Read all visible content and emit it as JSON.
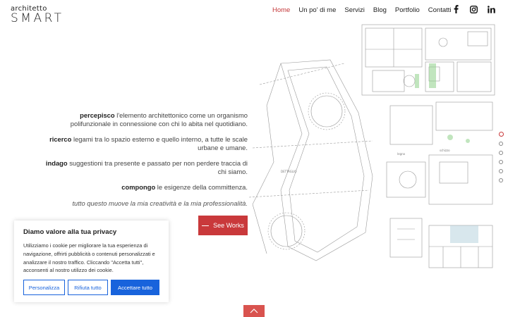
{
  "header": {
    "logo_top": "architetto",
    "logo_bottom": "SMART",
    "nav": [
      {
        "label": "Home",
        "active": true
      },
      {
        "label": "Un po' di me",
        "active": false
      },
      {
        "label": "Servizi",
        "active": false
      },
      {
        "label": "Blog",
        "active": false
      },
      {
        "label": "Portfolio",
        "active": false
      },
      {
        "label": "Contatti",
        "active": false
      }
    ],
    "social": [
      "facebook-icon",
      "instagram-icon",
      "linkedin-icon"
    ]
  },
  "manifesto": {
    "p1_bold": "percepisco",
    "p1_text": " l'elemento architettonico come un organismo polifunzionale in connessione con chi lo abita nel quotidiano.",
    "p2_bold": "ricerco",
    "p2_text": " legami tra lo spazio esterno e quello interno, a tutte le scale urbane e umane.",
    "p3_bold": "indago",
    "p3_text": " suggestioni tra presente e passato per non perdere traccia di chi siamo.",
    "p4_bold": "compongo",
    "p4_text": " le esigenze della committenza.",
    "p5_italic": "tutto questo muove la mia creatività e la mia professionalità."
  },
  "cta": {
    "label": "See Works"
  },
  "slider": {
    "count": 6,
    "active_index": 0
  },
  "cookie": {
    "title": "Diamo valore alla tua privacy",
    "text": "Utilizziamo i cookie per migliorare la tua esperienza di navigazione, offrirti pubblicità o contenuti personalizzati e analizzare il nostro traffico. Cliccando \"Accetta tutti\", acconsenti al nostro utilizzo dei cookie.",
    "btn_customize": "Personalizza",
    "btn_reject": "Rifiuta tutto",
    "btn_accept": "Accettare tutto"
  },
  "colors": {
    "accent": "#c9393b",
    "cookie_blue": "#1863dc"
  }
}
